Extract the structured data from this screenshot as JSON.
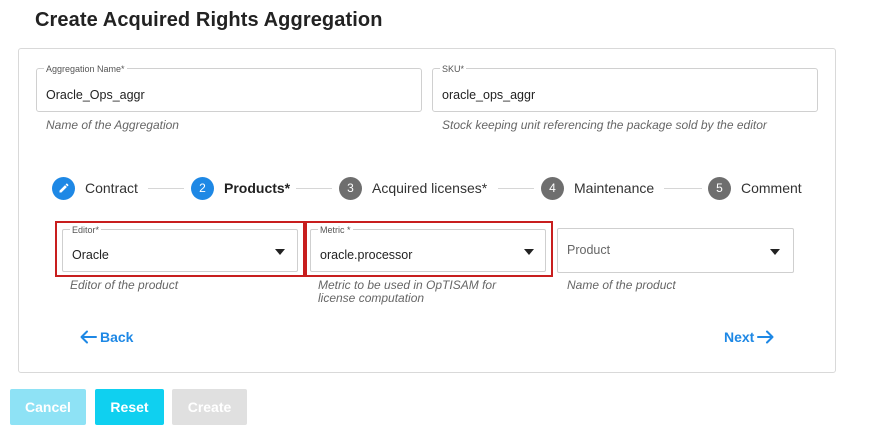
{
  "page": {
    "title": "Create Acquired Rights Aggregation"
  },
  "aggregation_name": {
    "label": "Aggregation Name*",
    "value": "Oracle_Ops_aggr",
    "hint": "Name of the Aggregation"
  },
  "sku": {
    "label": "SKU*",
    "value": "oracle_ops_aggr",
    "hint": "Stock keeping unit referencing the package sold by the editor"
  },
  "stepper": {
    "steps": [
      {
        "number": "1",
        "label": "Contract",
        "state": "done",
        "icon": "pencil-icon"
      },
      {
        "number": "2",
        "label": "Products*",
        "state": "active"
      },
      {
        "number": "3",
        "label": "Acquired licenses*",
        "state": "todo"
      },
      {
        "number": "4",
        "label": "Maintenance",
        "state": "todo"
      },
      {
        "number": "5",
        "label": "Comment",
        "state": "todo"
      }
    ]
  },
  "editor": {
    "label": "Editor*",
    "value": "Oracle",
    "hint": "Editor of the product"
  },
  "metric": {
    "label": "Metric *",
    "value": "oracle.processor",
    "hint_line1": "Metric to be used in OpTISAM for",
    "hint_line2": "license computation"
  },
  "product": {
    "placeholder": "Product",
    "hint": "Name of the product"
  },
  "nav": {
    "back_label": "Back",
    "next_label": "Next"
  },
  "actions": {
    "cancel_label": "Cancel",
    "reset_label": "Reset",
    "create_label": "Create"
  },
  "colors": {
    "primary": "#1e88e5",
    "highlight": "#c81e1e",
    "cancel": "#8ee2f5",
    "reset": "#0fd0f0",
    "create_disabled": "#e0e0e0"
  }
}
